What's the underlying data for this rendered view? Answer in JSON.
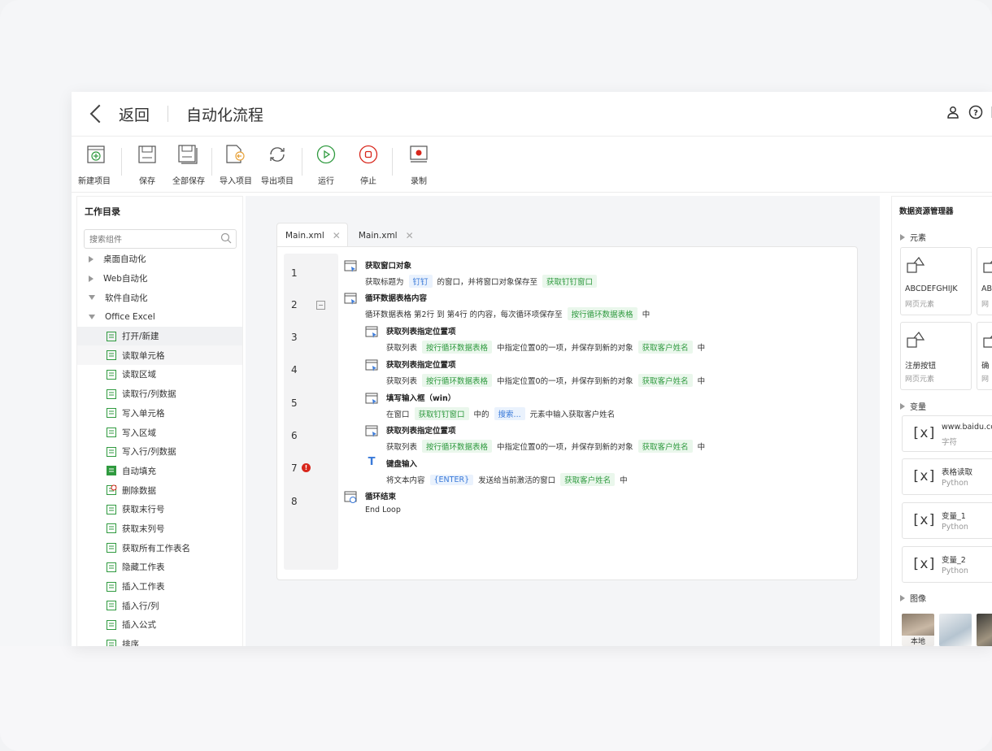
{
  "header": {
    "back_label": "返回",
    "title": "自动化流程"
  },
  "toolbar": {
    "new_project": "新建项目",
    "save": "保存",
    "save_all": "全部保存",
    "import_project": "导入项目",
    "export_project": "导出项目",
    "run": "运行",
    "stop": "停止",
    "record": "录制"
  },
  "left": {
    "title": "工作目录",
    "search_placeholder": "搜索组件",
    "categories": [
      "桌面自动化",
      "Web自动化",
      "软件自动化",
      "Office Excel"
    ],
    "items": [
      "打开/新建",
      "读取单元格",
      "读取区域",
      "读取行/列数据",
      "写入单元格",
      "写入区域",
      "写入行/列数据",
      "自动填充",
      "删除数据",
      "获取末行号",
      "获取末列号",
      "获取所有工作表名",
      "隐藏工作表",
      "插入工作表",
      "插入行/列",
      "插入公式",
      "排序"
    ]
  },
  "editor": {
    "tabs": [
      "Main.xml",
      "Main.xml"
    ],
    "line_numbers": [
      "1",
      "2",
      "3",
      "4",
      "5",
      "6",
      "7",
      "8"
    ],
    "steps": [
      {
        "title": "获取窗口对象",
        "parts": [
          "获取标题为",
          "钉钉",
          "的窗口，并将窗口对象保存至",
          "获取钉钉窗口"
        ]
      },
      {
        "title": "循环数据表格内容",
        "parts": [
          "循环数据表格 第2行 到 第4行 的内容，每次循环项保存至",
          "按行循环数据表格",
          "中"
        ]
      },
      {
        "title": "获取列表指定位置项",
        "parts": [
          "获取列表",
          "按行循环数据表格",
          "中指定位置0的一项，并保存到新的对象",
          "获取客户姓名",
          "中"
        ]
      },
      {
        "title": "获取列表指定位置项",
        "parts": [
          "获取列表",
          "按行循环数据表格",
          "中指定位置0的一项，并保存到新的对象",
          "获取客户姓名",
          "中"
        ]
      },
      {
        "title": "填写输入框（win）",
        "parts": [
          "在窗口",
          "获取钉钉窗口",
          "中的",
          "搜索...",
          "元素中输入获取客户姓名"
        ]
      },
      {
        "title": "获取列表指定位置项",
        "parts": [
          "获取列表",
          "按行循环数据表格",
          "中指定位置0的一项，并保存到新的对象",
          "获取客户姓名",
          "中"
        ]
      },
      {
        "title": "键盘输入",
        "parts": [
          "将文本内容",
          "{ENTER}",
          "发送给当前激活的窗口",
          "获取客户姓名",
          "中"
        ]
      },
      {
        "title": "循环结束",
        "parts": [
          "End Loop"
        ]
      }
    ]
  },
  "right": {
    "title": "数据资源管理器",
    "elements_label": "元素",
    "elements": [
      {
        "name": "ABCDEFGHIJK",
        "type": "网页元素"
      },
      {
        "name": "AB",
        "type": "网"
      },
      {
        "name": "注册按钮",
        "type": "网页元素"
      },
      {
        "name": "确",
        "type": "网"
      }
    ],
    "variables_label": "变量",
    "variables": [
      {
        "name": "www.baidu.co",
        "type": "字符"
      },
      {
        "name": "表格读取",
        "type": "Python"
      },
      {
        "name": "变量_1",
        "type": "Python"
      },
      {
        "name": "变量_2",
        "type": "Python"
      }
    ],
    "images_label": "图像",
    "image_local": "本地"
  },
  "colors": {
    "accent_green": "#2f9a3f",
    "accent_blue": "#3a7ad9",
    "error_red": "#d8261b"
  }
}
